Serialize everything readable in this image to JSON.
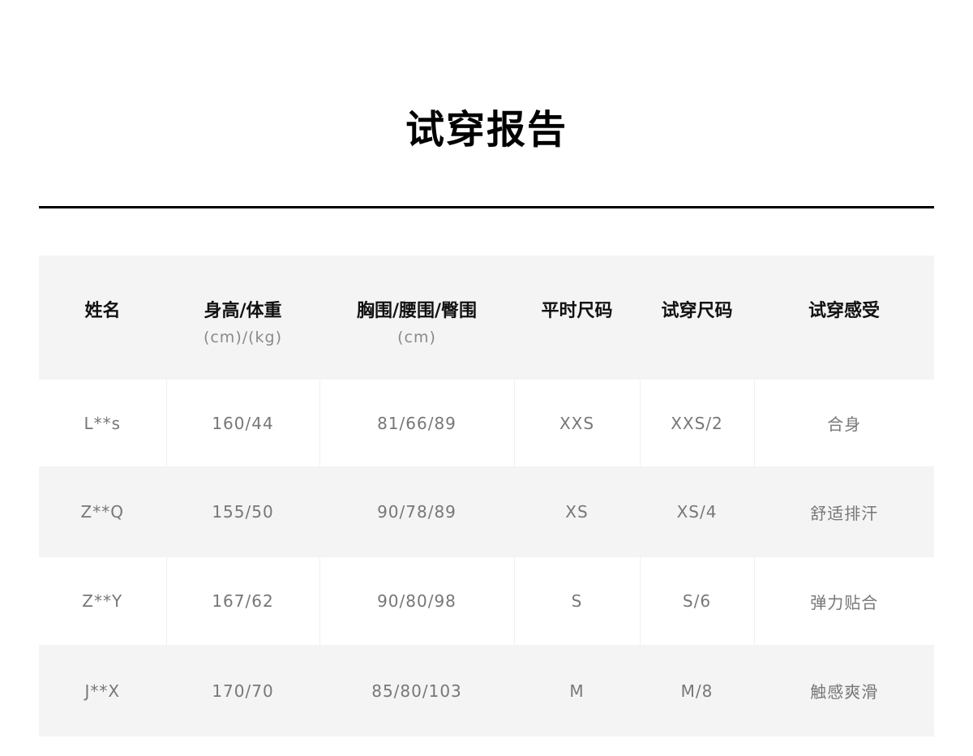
{
  "report": {
    "title": "试穿报告"
  },
  "table": {
    "headers": [
      {
        "label": "姓名",
        "unit": ""
      },
      {
        "label": "身高/体重",
        "unit": "(cm)/(kg)"
      },
      {
        "label": "胸围/腰围/臀围",
        "unit": "(cm)"
      },
      {
        "label": "平时尺码",
        "unit": ""
      },
      {
        "label": "试穿尺码",
        "unit": ""
      },
      {
        "label": "试穿感受",
        "unit": ""
      }
    ],
    "rows": [
      {
        "name": "L**s",
        "height_weight": "160/44",
        "measurements": "81/66/89",
        "usual_size": "XXS",
        "tried_size": "XXS/2",
        "feeling": "合身"
      },
      {
        "name": "Z**Q",
        "height_weight": "155/50",
        "measurements": "90/78/89",
        "usual_size": "XS",
        "tried_size": "XS/4",
        "feeling": "舒适排汗"
      },
      {
        "name": "Z**Y",
        "height_weight": "167/62",
        "measurements": "90/80/98",
        "usual_size": "S",
        "tried_size": "S/6",
        "feeling": "弹力贴合"
      },
      {
        "name": "J**X",
        "height_weight": "170/70",
        "measurements": "85/80/103",
        "usual_size": "M",
        "tried_size": "M/8",
        "feeling": "触感爽滑"
      }
    ]
  }
}
